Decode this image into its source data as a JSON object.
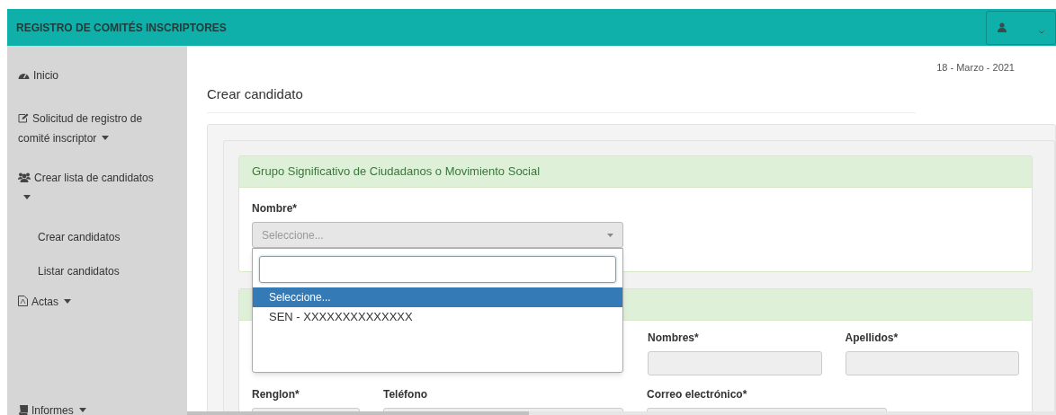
{
  "header": {
    "title": "REGISTRO DE COMITÉS INSCRIPTORES"
  },
  "sidebar": {
    "items": [
      {
        "label": "Inicio",
        "kind": "dashboard",
        "caret": false
      },
      {
        "label": "Solicitud de registro de comité inscriptor",
        "kind": "edit",
        "caret": true
      },
      {
        "label": "Crear lista de candidatos",
        "kind": "users",
        "caret": true,
        "children": [
          {
            "label": "Crear candidatos"
          },
          {
            "label": "Listar candidatos"
          }
        ]
      },
      {
        "label": "Actas",
        "kind": "pdf",
        "caret": true
      },
      {
        "label": "Informes",
        "kind": "book",
        "caret": true
      }
    ]
  },
  "date": "18 - Marzo - 2021",
  "page_title": "Crear candidato",
  "group_card": {
    "title": "Grupo Significativo de Ciudadanos o Movimiento Social",
    "label": "Nombre*",
    "select": {
      "placeholder": "Seleccione...",
      "expanded": true,
      "options": [
        {
          "label": "Seleccione...",
          "selected": true
        },
        {
          "label": "SEN - XXXXXXXXXXXXXX",
          "selected": false
        }
      ]
    }
  },
  "candidate_card": {
    "fields": [
      {
        "label": "Nombres*",
        "kind": "text"
      },
      {
        "label": "Apellidos*",
        "kind": "text"
      },
      {
        "label": "Renglon*",
        "kind": "select"
      },
      {
        "label": "Teléfono",
        "kind": "text"
      },
      {
        "label": "Correo electrónico*",
        "kind": "text"
      }
    ]
  }
}
